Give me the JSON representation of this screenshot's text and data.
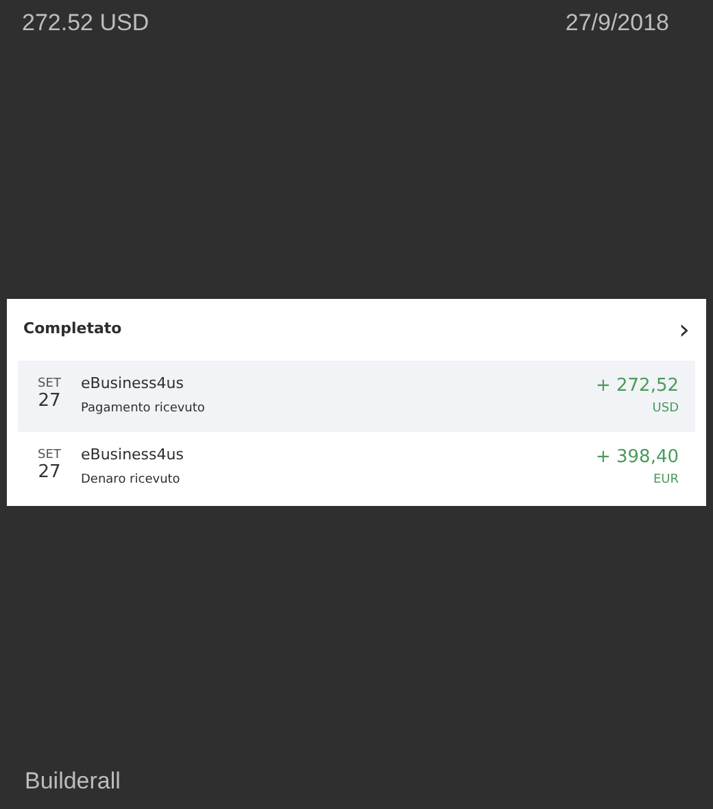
{
  "header": {
    "amount": "272.52 USD",
    "date": "27/9/2018"
  },
  "panel": {
    "title": "Completato",
    "chevron": "›",
    "transactions": [
      {
        "month": "SET",
        "day": "27",
        "name": "eBusiness4us",
        "description": "Pagamento ricevuto",
        "amount": "+ 272,52",
        "currency": "USD",
        "selected": true
      },
      {
        "month": "SET",
        "day": "27",
        "name": "eBusiness4us",
        "description": "Denaro ricevuto",
        "amount": "+ 398,40",
        "currency": "EUR",
        "selected": false
      }
    ]
  },
  "footer": {
    "label": "Builderall"
  }
}
